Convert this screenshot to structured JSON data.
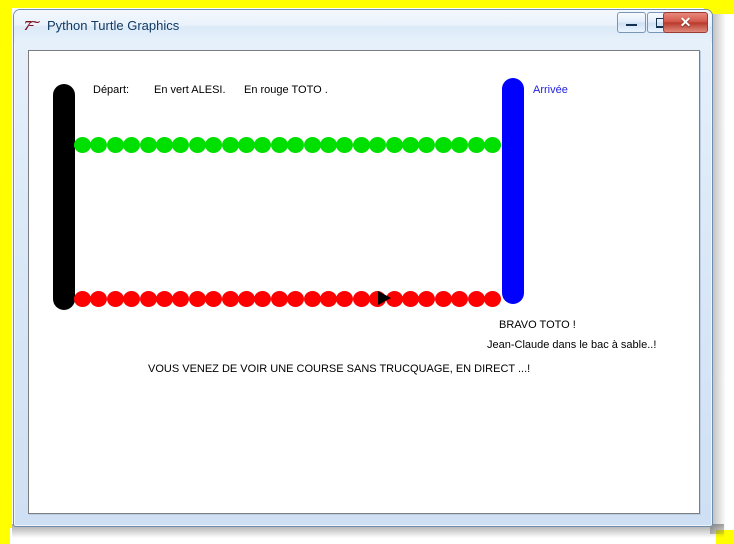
{
  "window": {
    "title": "Python Turtle Graphics",
    "icon": "python-turtle-icon",
    "icon_text": "7̵͠",
    "buttons": {
      "minimize": "–",
      "maximize": "❐",
      "close": "✕"
    }
  },
  "canvas": {
    "labels": {
      "depart": "Départ:",
      "en_vert": "En vert  ALESI.",
      "en_rouge": "En rouge TOTO .",
      "arrivee": "Arrivée",
      "bravo": "BRAVO TOTO !",
      "jeanclaude": "Jean-Claude dans le bac à sable..!",
      "course": "VOUS VENEZ DE VOIR UNE COURSE SANS TRUCQUAGE, EN DIRECT ...!"
    },
    "colors": {
      "start_bar": "#000000",
      "finish_bar": "#0000ff",
      "racer_green": "#00e000",
      "racer_red": "#ff0000",
      "turtle": "#000000",
      "background": "#ffffff",
      "arrivee_text": "#2222dd"
    },
    "race": {
      "green_racer": "ALESI",
      "red_racer": "TOTO",
      "green_dot_count": 26,
      "red_dot_count": 26,
      "turtle_dot_index": 15,
      "winner": "TOTO"
    }
  },
  "desktop": {
    "backdrop_color": "#ffff00"
  }
}
